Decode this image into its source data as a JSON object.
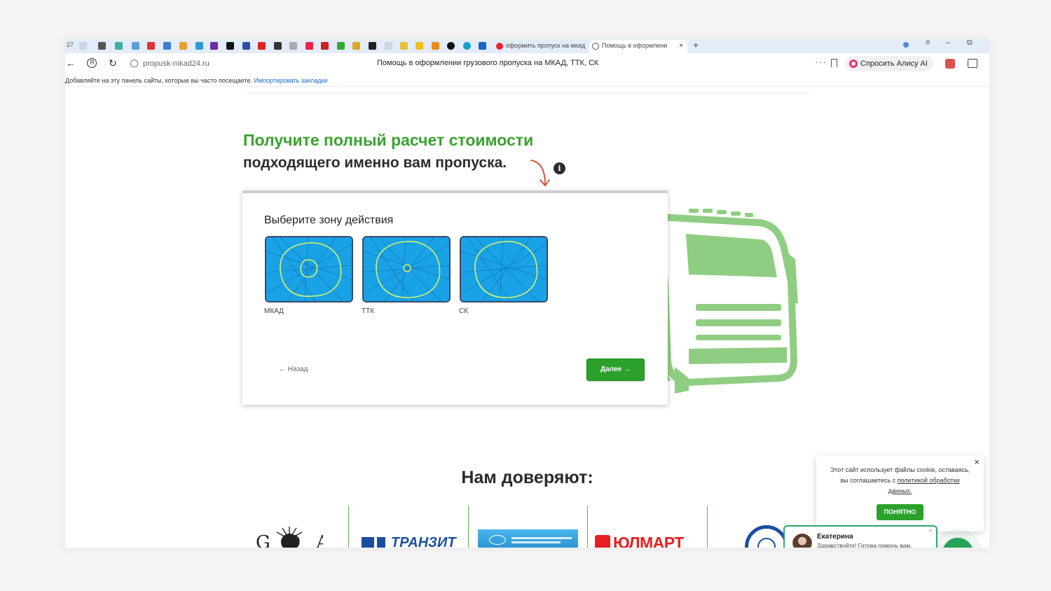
{
  "browser": {
    "tab_counter": "27",
    "tabs": [
      {
        "title": "оформить пропуск на мкад",
        "active": false
      },
      {
        "title": "Помощь в оформлени",
        "active": true
      }
    ],
    "new_tab_symbol": "+",
    "close_symbol": "×",
    "url": "propusk-mkad24.ru",
    "page_title": "Помощь в оформлении грузового пропуска на МКАД, ТТК, СК",
    "menu_dots": "···",
    "alice_label": "Спросить Алису AI",
    "bookmarks_hint": "Добавляйте на эту панель сайты, которые вы часто посещаете.",
    "bookmarks_import": "Импортировать закладки"
  },
  "hero": {
    "title_line1": "Получите полный расчет стоимости",
    "title_line2": "подходящего именно вам пропуска.",
    "info_glyph": "i"
  },
  "calculator": {
    "step_title": "Выберите зону действия",
    "zones": [
      {
        "label": "МКАД"
      },
      {
        "label": "ТТК"
      },
      {
        "label": "СК"
      }
    ],
    "back_label": "← Назад",
    "next_label": "Далее →"
  },
  "trust": {
    "title": "Нам доверяют:",
    "logos": [
      "GOA",
      "ТРАНЗИТ",
      "",
      "ЮЛМАРТ",
      ""
    ]
  },
  "cookie": {
    "text": "Этот сайт использует файлы cookie, оставаясь, вы соглашаетесь с",
    "link": "политикой обработки данных.",
    "button": "ПОНЯТНО",
    "close": "×"
  },
  "chat": {
    "name": "Екатерина",
    "message": "Здравствуйте! Готова помочь вам. Напишите мне, если у вас появятся вопросы.",
    "close": "×"
  },
  "colors": {
    "brand_green": "#3aa32f",
    "button_green": "#2ba12c",
    "map_blue": "#1a9ae0",
    "truck_green": "#8fce82"
  }
}
